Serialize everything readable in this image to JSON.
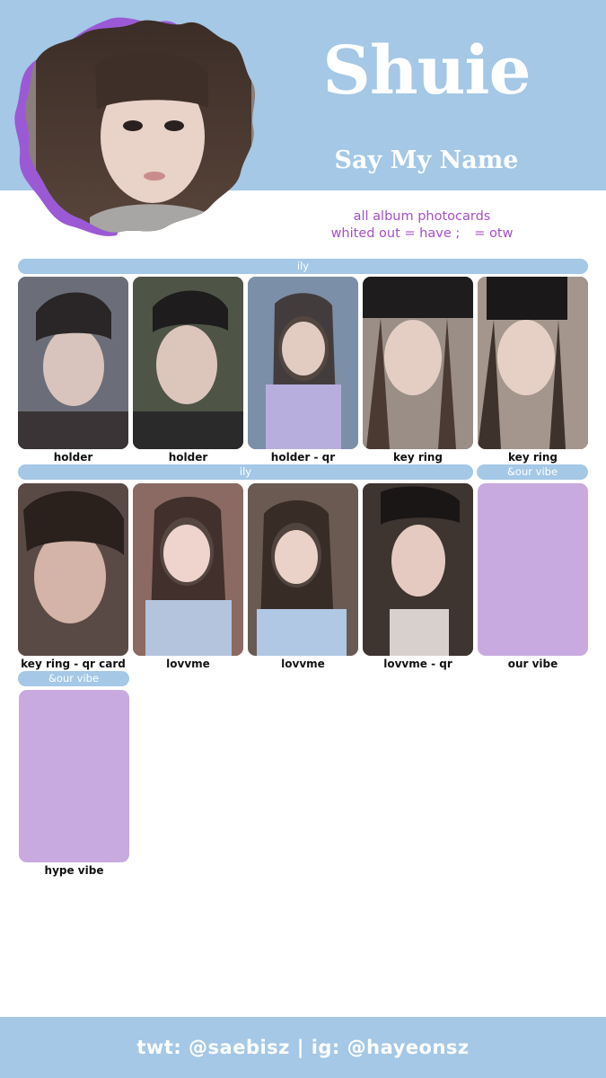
{
  "header": {
    "title": "Shuie",
    "subtitle": "Say My Name"
  },
  "caption": {
    "line1": "all album photocards",
    "line2a": "whited out = have ;",
    "line2b": "= otw"
  },
  "sections": [
    {
      "label": "ily"
    },
    {
      "label": "ily"
    },
    {
      "label": "&our vibe"
    },
    {
      "label": "&our vibe"
    }
  ],
  "cards": [
    {
      "label": "holder",
      "kind": "photo",
      "tone": "#6b6e78"
    },
    {
      "label": "holder",
      "kind": "photo",
      "tone": "#4e5446"
    },
    {
      "label": "holder - qr",
      "kind": "photo",
      "tone": "#7c8fa8"
    },
    {
      "label": "key ring",
      "kind": "photo",
      "tone": "#9a8e86"
    },
    {
      "label": "key ring",
      "kind": "photo",
      "tone": "#a4968c"
    },
    {
      "label": "key ring - qr card",
      "kind": "photo",
      "tone": "#5a4a45"
    },
    {
      "label": "lovvme",
      "kind": "photo",
      "tone": "#8a6a62"
    },
    {
      "label": "lovvme",
      "kind": "photo",
      "tone": "#6a5a52"
    },
    {
      "label": "lovvme - qr",
      "kind": "photo",
      "tone": "#3e3430"
    },
    {
      "label": "our vibe",
      "kind": "placeholder",
      "tone": "#c8aae0"
    },
    {
      "label": "hype vibe",
      "kind": "placeholder",
      "tone": "#c8aae0"
    }
  ],
  "colors": {
    "band": "#a4c8e6",
    "accent_purple": "#a44fc9",
    "placeholder": "#c8aae0",
    "blob": "#9b59d6"
  },
  "footer": {
    "text": "twt: @saebisz  |  ig: @hayeonsz"
  }
}
